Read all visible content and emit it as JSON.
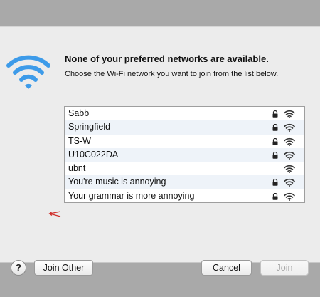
{
  "dialog": {
    "title": "None of your preferred networks are available.",
    "subtitle": "Choose the Wi-Fi network you want to join from the list below."
  },
  "networks": [
    {
      "name": "Sabb",
      "secured": true
    },
    {
      "name": "Springfield",
      "secured": true
    },
    {
      "name": "TS-W",
      "secured": true
    },
    {
      "name": "U10C022DA",
      "secured": true
    },
    {
      "name": "ubnt",
      "secured": false
    },
    {
      "name": "You're music is annoying",
      "secured": true
    },
    {
      "name": "Your grammar is more annoying",
      "secured": true
    }
  ],
  "buttons": {
    "help": "?",
    "join_other": "Join Other",
    "cancel": "Cancel",
    "join": "Join"
  },
  "colors": {
    "wifi_blue": "#3d9be9",
    "annotation_red": "#d0312d"
  }
}
